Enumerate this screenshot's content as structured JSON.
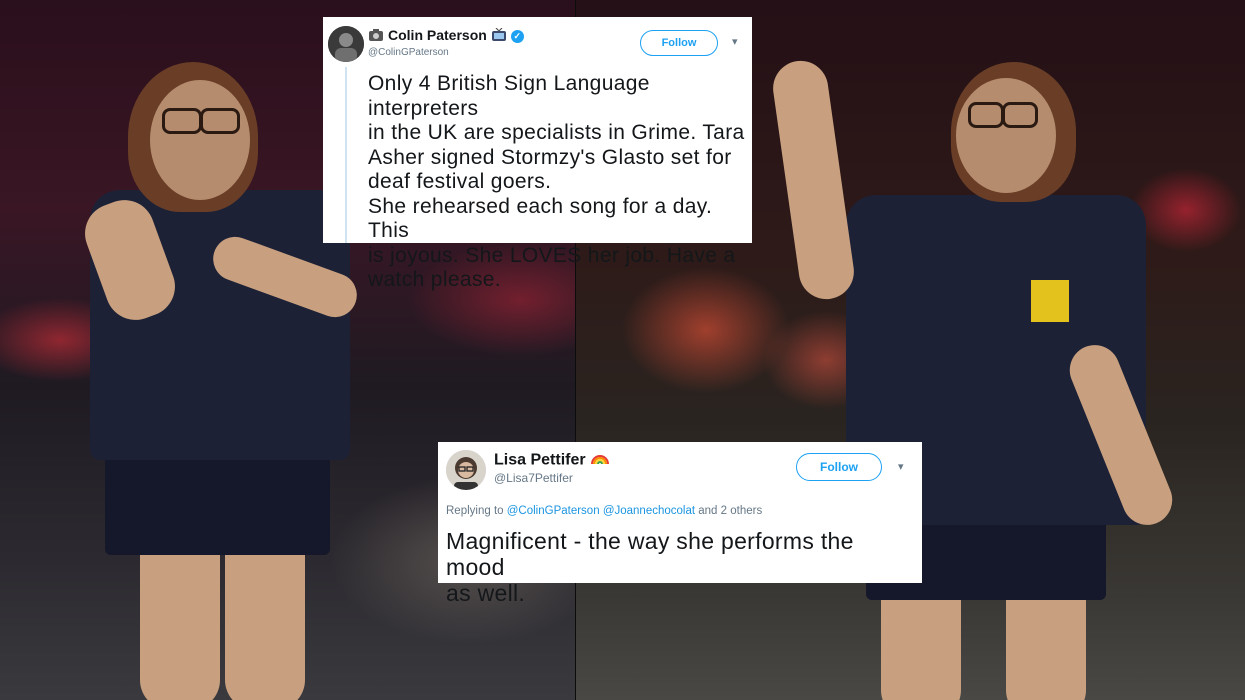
{
  "tweet_main": {
    "name": "Colin Paterson",
    "handle": "@ColinGPaterson",
    "follow_label": "Follow",
    "text": "Only 4 British Sign Language interpreters\nin the UK are specialists in Grime. Tara\nAsher signed Stormzy's Glasto set for\ndeaf festival goers.\nShe rehearsed each song for a day. This\nis joyous. She LOVES her job. Have a\nwatch please."
  },
  "tweet_reply": {
    "name": "Lisa Pettifer",
    "handle": "@Lisa7Pettifer",
    "follow_label": "Follow",
    "replying_prefix": "Replying to",
    "mention_1": "@ColinGPaterson",
    "mention_2": "@Joannechocolat",
    "replying_suffix": "and 2 others",
    "text": "Magnificent - the way she performs the mood\nas well."
  },
  "colors": {
    "twitter_blue": "#1da1f2",
    "text_dark": "#14171a",
    "text_gray": "#657786"
  },
  "icons": {
    "verified": "verified-badge-icon",
    "tv": "tv-emoji-icon",
    "camera": "camera-emoji-icon",
    "rainbow": "rainbow-emoji-icon",
    "chevron": "chevron-down-icon"
  }
}
